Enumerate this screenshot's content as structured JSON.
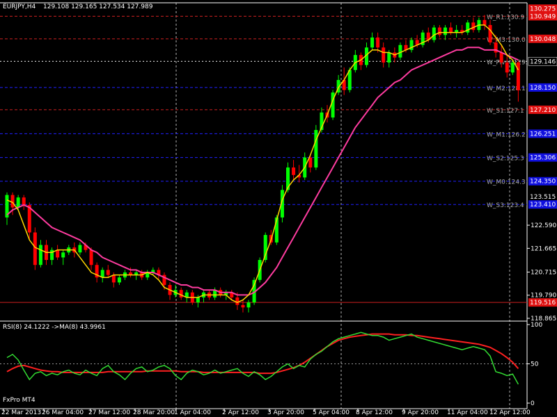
{
  "header": {
    "symbol": "EURJPY,H4",
    "ohlc": "129.108 129.165 127.534 127.989"
  },
  "watermark": "FxPro MT4",
  "colors": {
    "bull": "#00ff00",
    "bear": "#ff0000",
    "ma_fast": "#ffd700",
    "ma_slow": "#ff3ca0",
    "rsi": "#33dd33",
    "rsi_ma": "#ff2020",
    "red_line": "#d02020",
    "blue_line": "#2020ff",
    "grid": "#ffffff"
  },
  "chart_data": [
    {
      "type": "candlestick",
      "ylim": [
        118.865,
        131.1
      ],
      "y_ticks": [
        "122.590",
        "121.665",
        "120.715",
        "119.790",
        "118.865"
      ],
      "current_price": "129.146",
      "x_ticks": [
        "22 Mar 2013",
        "26 Mar 04:00",
        "27 Mar 12:00",
        "28 Mar 20:00",
        "1 Apr 04:00",
        "2 Apr 12:00",
        "3 Apr 20:00",
        "5 Apr 04:00",
        "8 Apr 12:00",
        "9 Apr 20:00",
        "11 Apr 04:00",
        "12 Apr 12:00"
      ],
      "candles": [
        {
          "o": 122.9,
          "h": 123.9,
          "l": 122.6,
          "c": 123.8
        },
        {
          "o": 123.8,
          "h": 123.9,
          "l": 123.0,
          "c": 123.3
        },
        {
          "o": 123.3,
          "h": 123.8,
          "l": 123.2,
          "c": 123.7
        },
        {
          "o": 123.7,
          "h": 123.8,
          "l": 123.2,
          "c": 123.4
        },
        {
          "o": 123.4,
          "h": 123.5,
          "l": 122.0,
          "c": 122.3
        },
        {
          "o": 122.3,
          "h": 122.5,
          "l": 120.8,
          "c": 121.0
        },
        {
          "o": 121.0,
          "h": 122.0,
          "l": 120.9,
          "c": 121.8
        },
        {
          "o": 121.8,
          "h": 122.0,
          "l": 121.0,
          "c": 121.2
        },
        {
          "o": 121.2,
          "h": 121.7,
          "l": 121.0,
          "c": 121.6
        },
        {
          "o": 121.6,
          "h": 121.8,
          "l": 121.2,
          "c": 121.3
        },
        {
          "o": 121.3,
          "h": 121.6,
          "l": 121.0,
          "c": 121.5
        },
        {
          "o": 121.5,
          "h": 121.8,
          "l": 121.4,
          "c": 121.7
        },
        {
          "o": 121.7,
          "h": 121.9,
          "l": 121.3,
          "c": 121.5
        },
        {
          "o": 121.5,
          "h": 121.9,
          "l": 121.4,
          "c": 121.8
        },
        {
          "o": 121.8,
          "h": 121.9,
          "l": 121.5,
          "c": 121.6
        },
        {
          "o": 121.6,
          "h": 121.7,
          "l": 120.8,
          "c": 121.0
        },
        {
          "o": 121.0,
          "h": 121.1,
          "l": 120.3,
          "c": 120.5
        },
        {
          "o": 120.5,
          "h": 120.9,
          "l": 120.3,
          "c": 120.8
        },
        {
          "o": 120.8,
          "h": 121.0,
          "l": 120.5,
          "c": 120.6
        },
        {
          "o": 120.6,
          "h": 120.7,
          "l": 120.1,
          "c": 120.3
        },
        {
          "o": 120.3,
          "h": 120.6,
          "l": 120.2,
          "c": 120.5
        },
        {
          "o": 120.5,
          "h": 120.8,
          "l": 120.4,
          "c": 120.7
        },
        {
          "o": 120.7,
          "h": 120.9,
          "l": 120.5,
          "c": 120.6
        },
        {
          "o": 120.6,
          "h": 120.8,
          "l": 120.4,
          "c": 120.7
        },
        {
          "o": 120.7,
          "h": 120.8,
          "l": 120.4,
          "c": 120.5
        },
        {
          "o": 120.5,
          "h": 120.8,
          "l": 120.4,
          "c": 120.7
        },
        {
          "o": 120.7,
          "h": 120.9,
          "l": 120.6,
          "c": 120.8
        },
        {
          "o": 120.8,
          "h": 120.9,
          "l": 120.4,
          "c": 120.6
        },
        {
          "o": 120.6,
          "h": 120.7,
          "l": 120.0,
          "c": 120.2
        },
        {
          "o": 120.2,
          "h": 120.3,
          "l": 119.6,
          "c": 119.8
        },
        {
          "o": 119.8,
          "h": 120.2,
          "l": 119.7,
          "c": 120.0
        },
        {
          "o": 120.0,
          "h": 120.1,
          "l": 119.6,
          "c": 119.7
        },
        {
          "o": 119.7,
          "h": 120.0,
          "l": 119.5,
          "c": 119.9
        },
        {
          "o": 119.9,
          "h": 120.0,
          "l": 119.4,
          "c": 119.5
        },
        {
          "o": 119.5,
          "h": 119.8,
          "l": 119.3,
          "c": 119.7
        },
        {
          "o": 119.7,
          "h": 120.0,
          "l": 119.5,
          "c": 119.9
        },
        {
          "o": 119.9,
          "h": 120.0,
          "l": 119.6,
          "c": 119.7
        },
        {
          "o": 119.7,
          "h": 120.1,
          "l": 119.6,
          "c": 120.0
        },
        {
          "o": 120.0,
          "h": 120.1,
          "l": 119.7,
          "c": 119.8
        },
        {
          "o": 119.8,
          "h": 120.0,
          "l": 119.6,
          "c": 119.9
        },
        {
          "o": 119.9,
          "h": 120.0,
          "l": 119.6,
          "c": 119.7
        },
        {
          "o": 119.7,
          "h": 119.9,
          "l": 119.2,
          "c": 119.4
        },
        {
          "o": 119.4,
          "h": 119.6,
          "l": 119.1,
          "c": 119.3
        },
        {
          "o": 119.3,
          "h": 119.6,
          "l": 119.1,
          "c": 119.5
        },
        {
          "o": 119.5,
          "h": 120.5,
          "l": 119.4,
          "c": 120.4
        },
        {
          "o": 120.4,
          "h": 121.3,
          "l": 120.3,
          "c": 121.2
        },
        {
          "o": 121.2,
          "h": 122.3,
          "l": 121.1,
          "c": 122.2
        },
        {
          "o": 122.2,
          "h": 122.4,
          "l": 121.8,
          "c": 121.9
        },
        {
          "o": 121.9,
          "h": 123.0,
          "l": 121.8,
          "c": 122.9
        },
        {
          "o": 122.9,
          "h": 124.2,
          "l": 122.7,
          "c": 124.0
        },
        {
          "o": 124.0,
          "h": 125.1,
          "l": 123.9,
          "c": 124.9
        },
        {
          "o": 124.9,
          "h": 125.2,
          "l": 124.4,
          "c": 124.6
        },
        {
          "o": 124.6,
          "h": 125.0,
          "l": 124.3,
          "c": 124.5
        },
        {
          "o": 124.5,
          "h": 125.5,
          "l": 124.4,
          "c": 125.3
        },
        {
          "o": 125.3,
          "h": 125.4,
          "l": 124.7,
          "c": 124.9
        },
        {
          "o": 124.9,
          "h": 126.6,
          "l": 124.8,
          "c": 126.4
        },
        {
          "o": 126.4,
          "h": 127.3,
          "l": 126.3,
          "c": 127.1
        },
        {
          "o": 127.1,
          "h": 127.4,
          "l": 126.7,
          "c": 126.9
        },
        {
          "o": 126.9,
          "h": 128.0,
          "l": 126.8,
          "c": 127.9
        },
        {
          "o": 127.9,
          "h": 128.6,
          "l": 127.8,
          "c": 128.4
        },
        {
          "o": 128.4,
          "h": 128.9,
          "l": 127.8,
          "c": 128.0
        },
        {
          "o": 128.0,
          "h": 128.9,
          "l": 127.9,
          "c": 128.8
        },
        {
          "o": 128.8,
          "h": 129.6,
          "l": 128.7,
          "c": 129.4
        },
        {
          "o": 129.4,
          "h": 129.5,
          "l": 128.8,
          "c": 129.0
        },
        {
          "o": 129.0,
          "h": 129.9,
          "l": 128.9,
          "c": 129.7
        },
        {
          "o": 129.7,
          "h": 130.3,
          "l": 129.6,
          "c": 130.1
        },
        {
          "o": 130.1,
          "h": 130.3,
          "l": 129.5,
          "c": 129.7
        },
        {
          "o": 129.7,
          "h": 129.9,
          "l": 128.9,
          "c": 129.1
        },
        {
          "o": 129.1,
          "h": 129.6,
          "l": 128.9,
          "c": 129.5
        },
        {
          "o": 129.5,
          "h": 129.7,
          "l": 129.1,
          "c": 129.3
        },
        {
          "o": 129.3,
          "h": 129.9,
          "l": 129.2,
          "c": 129.8
        },
        {
          "o": 129.8,
          "h": 130.0,
          "l": 129.5,
          "c": 129.6
        },
        {
          "o": 129.6,
          "h": 130.1,
          "l": 129.5,
          "c": 130.0
        },
        {
          "o": 130.0,
          "h": 130.2,
          "l": 129.7,
          "c": 129.8
        },
        {
          "o": 129.8,
          "h": 130.4,
          "l": 129.7,
          "c": 130.3
        },
        {
          "o": 130.3,
          "h": 130.5,
          "l": 129.9,
          "c": 130.0
        },
        {
          "o": 130.0,
          "h": 130.6,
          "l": 129.9,
          "c": 130.5
        },
        {
          "o": 130.5,
          "h": 130.6,
          "l": 130.1,
          "c": 130.2
        },
        {
          "o": 130.2,
          "h": 130.6,
          "l": 130.0,
          "c": 130.5
        },
        {
          "o": 130.5,
          "h": 130.7,
          "l": 130.2,
          "c": 130.3
        },
        {
          "o": 130.3,
          "h": 130.6,
          "l": 130.1,
          "c": 130.4
        },
        {
          "o": 130.4,
          "h": 130.6,
          "l": 130.2,
          "c": 130.3
        },
        {
          "o": 130.3,
          "h": 130.8,
          "l": 130.2,
          "c": 130.7
        },
        {
          "o": 130.7,
          "h": 130.9,
          "l": 130.3,
          "c": 130.4
        },
        {
          "o": 130.4,
          "h": 130.9,
          "l": 130.3,
          "c": 130.8
        },
        {
          "o": 130.8,
          "h": 131.0,
          "l": 130.4,
          "c": 130.6
        },
        {
          "o": 130.6,
          "h": 130.8,
          "l": 129.8,
          "c": 129.9
        },
        {
          "o": 129.9,
          "h": 130.2,
          "l": 129.3,
          "c": 129.5
        },
        {
          "o": 129.5,
          "h": 129.8,
          "l": 128.9,
          "c": 129.1
        },
        {
          "o": 129.1,
          "h": 129.4,
          "l": 128.5,
          "c": 128.7
        },
        {
          "o": 128.7,
          "h": 129.2,
          "l": 128.6,
          "c": 129.1
        },
        {
          "o": 129.108,
          "h": 129.165,
          "l": 127.534,
          "c": 127.989
        }
      ],
      "ma_fast": [
        123.6,
        123.5,
        123.2,
        122.6,
        122.0,
        121.7,
        121.6,
        121.5,
        121.5,
        121.6,
        121.6,
        121.6,
        121.6,
        121.3,
        121.0,
        120.7,
        120.6,
        120.5,
        120.5,
        120.6,
        120.6,
        120.6,
        120.6,
        120.6,
        120.6,
        120.7,
        120.6,
        120.4,
        120.1,
        120.0,
        119.9,
        119.8,
        119.7,
        119.7,
        119.7,
        119.8,
        119.8,
        119.8,
        119.8,
        119.8,
        119.6,
        119.5,
        119.6,
        119.8,
        120.2,
        120.8,
        121.4,
        122.0,
        122.8,
        123.6,
        124.1,
        124.4,
        124.6,
        124.9,
        125.4,
        126.0,
        126.5,
        127.0,
        127.6,
        128.1,
        128.4,
        128.8,
        129.1,
        129.2,
        129.4,
        129.6,
        129.6,
        129.5,
        129.5,
        129.4,
        129.5,
        129.6,
        129.7,
        129.8,
        129.9,
        130.0,
        130.2,
        130.3,
        130.3,
        130.3,
        130.3,
        130.3,
        130.4,
        130.5,
        130.6,
        130.6,
        130.4,
        130.1,
        129.8,
        129.4,
        129.2,
        128.8
      ],
      "ma_slow": [
        123.0,
        123.2,
        123.3,
        123.4,
        123.3,
        123.1,
        122.9,
        122.7,
        122.5,
        122.4,
        122.3,
        122.2,
        122.1,
        122.0,
        121.8,
        121.6,
        121.5,
        121.3,
        121.2,
        121.1,
        121.0,
        120.9,
        120.8,
        120.8,
        120.7,
        120.7,
        120.7,
        120.6,
        120.5,
        120.4,
        120.3,
        120.2,
        120.2,
        120.1,
        120.1,
        120.0,
        120.0,
        120.0,
        119.9,
        119.9,
        119.9,
        119.8,
        119.8,
        119.8,
        119.9,
        120.1,
        120.3,
        120.6,
        120.9,
        121.3,
        121.7,
        122.1,
        122.5,
        122.9,
        123.3,
        123.7,
        124.1,
        124.5,
        124.9,
        125.3,
        125.7,
        126.1,
        126.5,
        126.8,
        127.1,
        127.4,
        127.7,
        127.9,
        128.1,
        128.3,
        128.4,
        128.6,
        128.8,
        128.9,
        129.0,
        129.1,
        129.2,
        129.3,
        129.4,
        129.5,
        129.6,
        129.6,
        129.7,
        129.7,
        129.7,
        129.6,
        129.6,
        129.6,
        129.5,
        129.4,
        129.3,
        129.2
      ],
      "levels": [
        {
          "name": "W_R1",
          "text": "W_R1:130.9",
          "price": 130.949,
          "price_text": "130.949",
          "kind": "red"
        },
        {
          "name": "W_M3",
          "text": "W_M3:130.0",
          "price": 130.048,
          "price_text": "130.048",
          "kind": "red"
        },
        {
          "name": "W_Pivot",
          "text": "W_Pivot:129.",
          "price": 129.146,
          "price_text": "",
          "kind": "white"
        },
        {
          "name": "W_M2",
          "text": "W_M2:128.1",
          "price": 128.1,
          "price_text": "128.150",
          "kind": "blue"
        },
        {
          "name": "W_S1",
          "text": "W_S1:127.1",
          "price": 127.21,
          "price_text": "127.210",
          "kind": "red"
        },
        {
          "name": "W_M1",
          "text": "W_M1:126.2",
          "price": 126.25,
          "price_text": "126.251",
          "kind": "blue"
        },
        {
          "name": "W_S2",
          "text": "W_S2:125.3",
          "price": 125.3,
          "price_text": "125.306",
          "kind": "blue"
        },
        {
          "name": "W_M0",
          "text": "W_M0:124.3",
          "price": 124.35,
          "price_text": "124.350",
          "kind": "blue"
        },
        {
          "name": "W_S3",
          "text": "W_S3:123.4",
          "price": 123.42,
          "price_text": "123.410",
          "kind": "blue"
        },
        {
          "name": "bottom",
          "text": "",
          "price": 119.5,
          "price_text": "119.516",
          "kind": "red"
        }
      ],
      "top_tag": "130.275",
      "axis_label_extra": "123.515"
    },
    {
      "type": "line",
      "title": "RSI(8) 24.1222  ->MA(8) 43.9961",
      "ylim": [
        0,
        100
      ],
      "y_ticks": [
        "100",
        "50",
        "0"
      ],
      "series": [
        {
          "name": "RSI(8)",
          "values": [
            58,
            62,
            55,
            42,
            30,
            38,
            40,
            35,
            38,
            36,
            40,
            42,
            38,
            36,
            42,
            38,
            35,
            44,
            48,
            40,
            36,
            30,
            38,
            44,
            46,
            40,
            42,
            46,
            48,
            44,
            35,
            30,
            38,
            42,
            40,
            36,
            38,
            42,
            38,
            40,
            42,
            44,
            38,
            34,
            40,
            36,
            30,
            34,
            40,
            46,
            50,
            44,
            48,
            46,
            56,
            62,
            66,
            72,
            78,
            82,
            84,
            86,
            88,
            90,
            88,
            86,
            86,
            84,
            80,
            82,
            84,
            86,
            88,
            84,
            82,
            80,
            78,
            76,
            74,
            72,
            70,
            68,
            70,
            72,
            70,
            68,
            60,
            40,
            38,
            35,
            37,
            24
          ]
        },
        {
          "name": "MA(8)",
          "values": [
            40,
            44,
            47,
            48,
            46,
            44,
            42,
            41,
            40,
            40,
            39,
            39,
            39,
            39,
            39,
            39,
            39,
            39,
            40,
            40,
            40,
            40,
            40,
            40,
            40,
            41,
            41,
            41,
            41,
            41,
            41,
            40,
            40,
            40,
            40,
            39,
            39,
            39,
            39,
            39,
            39,
            39,
            39,
            39,
            39,
            38,
            38,
            38,
            39,
            41,
            43,
            45,
            48,
            52,
            57,
            62,
            67,
            72,
            76,
            80,
            82,
            84,
            85,
            86,
            87,
            88,
            88,
            88,
            88,
            87,
            87,
            87,
            86,
            86,
            85,
            84,
            83,
            82,
            81,
            80,
            79,
            78,
            77,
            76,
            75,
            73,
            71,
            67,
            63,
            58,
            52,
            44
          ]
        }
      ]
    }
  ]
}
